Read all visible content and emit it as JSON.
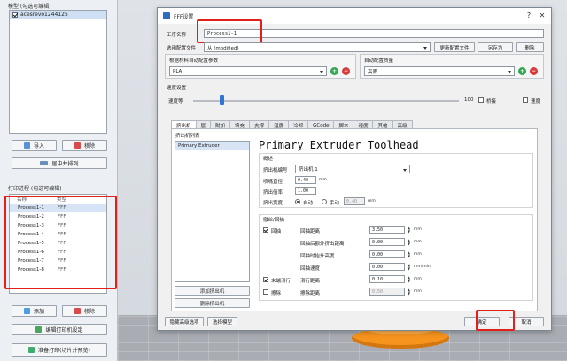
{
  "left": {
    "model_section_title": "模型 (勾选可编辑)",
    "models": [
      {
        "label": "acesrevo1244125",
        "checked": true
      }
    ],
    "import_label": "导入",
    "delete_label": "移除",
    "center_arrange_label": "居中并排列",
    "process_section_title": "打印进程 (勾选可编辑)",
    "process_header": {
      "name": "名称",
      "type": "类型"
    },
    "processes": [
      {
        "name": "Process1-1",
        "type": "FFF"
      },
      {
        "name": "Process1-2",
        "type": "FFF"
      },
      {
        "name": "Process1-3",
        "type": "FFF"
      },
      {
        "name": "Process1-4",
        "type": "FFF"
      },
      {
        "name": "Process1-5",
        "type": "FFF"
      },
      {
        "name": "Process1-6",
        "type": "FFF"
      },
      {
        "name": "Process1-7",
        "type": "FFF"
      },
      {
        "name": "Process1-8",
        "type": "FFF"
      }
    ],
    "add_label": "添加",
    "remove_label": "移除",
    "edit_process_label": "编辑打印机设定",
    "prepare_label": "准备打印(切片并预览)"
  },
  "dialog": {
    "title": "FFF设置",
    "process_name_label": "工序名称",
    "process_name_value": "Process1-1",
    "preset_label": "选用配置文件",
    "preset_value": "从 (modified)",
    "update_preset_label": "更新配置文件",
    "save_as_label": "另存为",
    "remove_preset_label": "删除",
    "auto_material_label": "根据材料自动配置参数",
    "material_value": "PLA",
    "auto_quality_label": "自动配置质量",
    "quality_value": "高质",
    "speed_section_label": "速度设置",
    "speed_label": "速度等",
    "speed_right_label": "100",
    "tabs": [
      "挤出机",
      "层",
      "附加",
      "填充",
      "支撑",
      "温度",
      "冷却",
      "GCode",
      "脚本",
      "速度",
      "其他",
      "高级"
    ],
    "extruder_list_title": "挤出机列表",
    "extruder_items": [
      "Primary Extruder"
    ],
    "add_extruder_label": "添加挤出机",
    "delete_extruder_label": "删除挤出机",
    "toolhead_title": "Primary Extruder Toolhead",
    "general_section": "概述",
    "extruder_index_label": "挤出机编号",
    "extruder_index_value": "挤出机 1",
    "nozzle_label": "喷嘴直径",
    "nozzle_value": "0.40",
    "nozzle_unit": "mm",
    "multiplier_label": "挤出倍率",
    "multiplier_value": "1.00",
    "width_label": "挤出宽度",
    "width_auto": "自动",
    "width_manual": "手动",
    "width_value": "0.40",
    "width_unit": "mm",
    "retraction_section": "撤丝/回抽",
    "retraction_label": "回抽",
    "retraction_distance_label": "回抽距离",
    "retraction_distance_value": "3.50",
    "retraction_distance_unit": "mm",
    "extra_restart_label": "回抽后额外挤出距离",
    "extra_restart_value": "0.00",
    "extra_restart_unit": "mm",
    "vertical_lift_label": "回抽时抬升高度",
    "vertical_lift_value": "0.00",
    "vertical_lift_unit": "mm",
    "retraction_speed_label": "回抽速度",
    "retraction_speed_value": "0.00",
    "retraction_speed_unit": "mm/min",
    "coast_label": "末端滑行",
    "coast_distance_label": "滑行距离",
    "coast_distance_value": "0.10",
    "coast_distance_unit": "mm",
    "wipe_label": "擦除",
    "wipe_distance_label": "擦除距离",
    "wipe_distance_value": "0.50",
    "wipe_distance_unit": "mm",
    "advanced_option_label": "隐藏高级选项",
    "select_model_label": "选择模型",
    "ok_label": "确定",
    "cancel_label": "取消",
    "right_check1_label": "桥接",
    "right_check2_label": "速度"
  }
}
